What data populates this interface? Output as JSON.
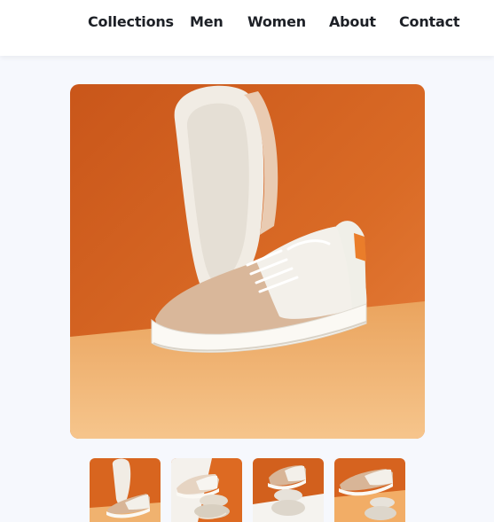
{
  "nav": {
    "items": [
      {
        "label": "Collections"
      },
      {
        "label": "Men"
      },
      {
        "label": "Women"
      },
      {
        "label": "About"
      },
      {
        "label": "Contact"
      }
    ]
  },
  "product": {
    "main_image_icon": "sneaker-photo-icon",
    "thumbnails": [
      {
        "icon": "sneaker-thumbnail-icon"
      },
      {
        "icon": "sneaker-thumbnail-icon"
      },
      {
        "icon": "sneaker-thumbnail-icon"
      },
      {
        "icon": "sneaker-thumbnail-icon"
      }
    ]
  },
  "colors": {
    "background": "#f6f8fd",
    "text": "#1d2026",
    "photo_orange": "#d4621e",
    "photo_sand": "#f2b676"
  }
}
